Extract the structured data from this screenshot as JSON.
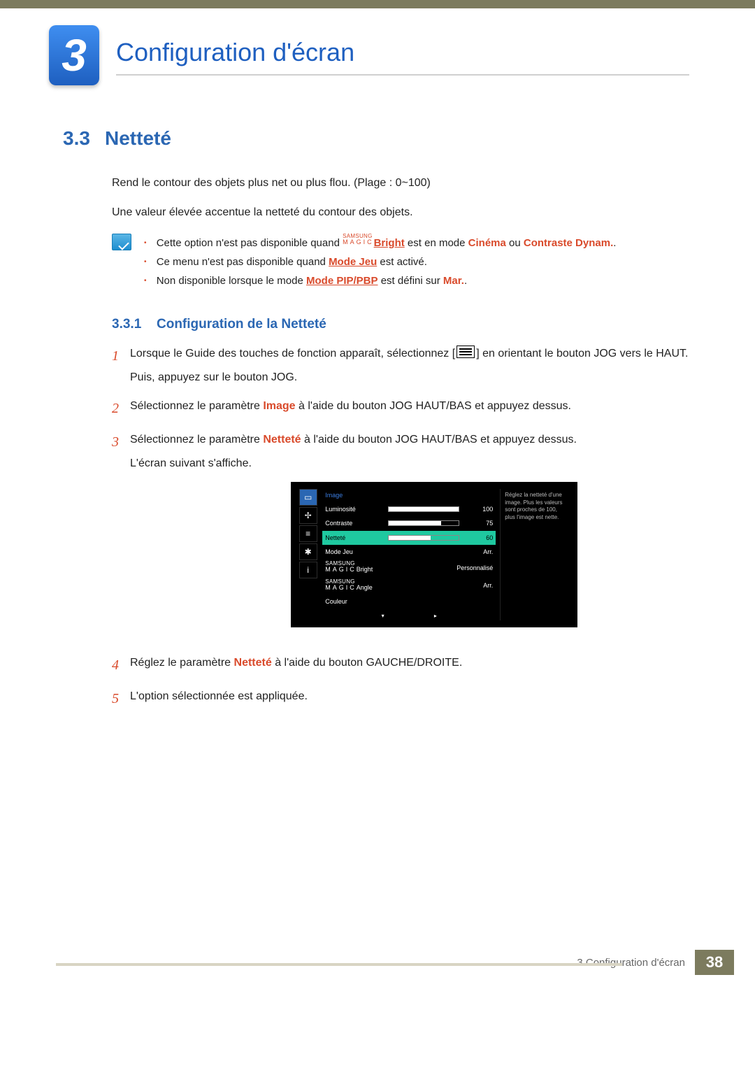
{
  "chapter": {
    "number": "3",
    "title": "Configuration d'écran"
  },
  "section": {
    "number": "3.3",
    "title": "Netteté"
  },
  "intro": {
    "p1": "Rend le contour des objets plus net ou plus flou. (Plage : 0~100)",
    "p2": "Une valeur élevée accentue la netteté du contour des objets."
  },
  "note": {
    "magic_top": "SAMSUNG",
    "magic_bot": "MAGIC",
    "b1_pre": "Cette option n'est pas disponible quand ",
    "b1_bright": "Bright",
    "b1_mid": " est en mode ",
    "b1_cinema": "Cinéma",
    "b1_or": " ou ",
    "b1_contrast": "Contraste Dynam.",
    "b1_post": ".",
    "b2_pre": "Ce menu n'est pas disponible quand ",
    "b2_mode": "Mode Jeu",
    "b2_post": " est activé.",
    "b3_pre": "Non disponible lorsque le mode ",
    "b3_mode": "Mode PIP/PBP",
    "b3_mid": " est défini sur ",
    "b3_val": "Mar.",
    "b3_post": "."
  },
  "subsection": {
    "number": "3.3.1",
    "title": "Configuration de la Netteté"
  },
  "steps": {
    "s1a": "Lorsque le Guide des touches de fonction apparaît, sélectionnez [",
    "s1b": "] en orientant le bouton JOG vers le HAUT.",
    "s1c": "Puis, appuyez sur le bouton JOG.",
    "s2_pre": "Sélectionnez le paramètre ",
    "s2_word": "Image",
    "s2_post": " à l'aide du bouton JOG HAUT/BAS et appuyez dessus.",
    "s3_pre": "Sélectionnez le paramètre ",
    "s3_word": "Netteté",
    "s3_post": " à l'aide du bouton JOG HAUT/BAS et appuyez dessus.",
    "s3_extra": "L'écran suivant s'affiche.",
    "s4_pre": "Réglez le paramètre ",
    "s4_word": "Netteté",
    "s4_post": " à l'aide du bouton GAUCHE/DROITE.",
    "s5": "L'option sélectionnée est appliquée.",
    "n1": "1",
    "n2": "2",
    "n3": "3",
    "n4": "4",
    "n5": "5"
  },
  "osd": {
    "title": "Image",
    "rows": [
      {
        "label": "Luminosité",
        "value": "100",
        "pct": 100
      },
      {
        "label": "Contraste",
        "value": "75",
        "pct": 75
      },
      {
        "label": "Netteté",
        "value": "60",
        "pct": 60,
        "selected": true
      },
      {
        "label": "Mode Jeu",
        "text": "Arr."
      },
      {
        "label_magic": "Bright",
        "text": "Personnalisé"
      },
      {
        "label_magic": "Angle",
        "text": "Arr."
      },
      {
        "label": "Couleur",
        "text": ""
      }
    ],
    "help": "Réglez la netteté d'une image. Plus les valeurs sont proches de 100, plus l'image est nette.",
    "magic_top": "SAMSUNG",
    "magic_bot": "MAGIC",
    "nav_icons": [
      "▭",
      "✢",
      "≡",
      "✱",
      "i"
    ]
  },
  "footer": {
    "label": "3 Configuration d'écran",
    "page": "38"
  }
}
